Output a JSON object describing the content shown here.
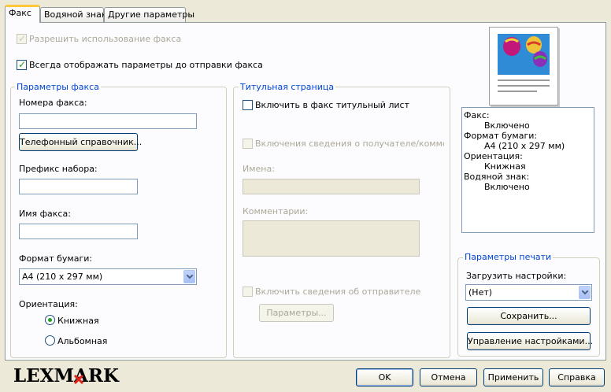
{
  "tabs": [
    "Факс",
    "Водяной знак",
    "Другие параметры"
  ],
  "options": {
    "allow_fax": "Разрешить использование факса",
    "always_show": "Всегда отображать параметры до отправки факса"
  },
  "fax_params": {
    "title": "Параметры факса",
    "fax_numbers_label": "Номера факса:",
    "fax_numbers_value": "",
    "phonebook_button": "Телефонный справочник...",
    "dial_prefix_label": "Префикс набора:",
    "dial_prefix_value": "",
    "fax_name_label": "Имя факса:",
    "fax_name_value": "",
    "paper_size_label": "Формат бумаги:",
    "paper_size_value": "A4 (210 x 297 мм)",
    "orientation_label": "Ориентация:",
    "portrait": "Книжная",
    "landscape": "Альбомная"
  },
  "cover_page": {
    "title": "Титульная страница",
    "include_cover": "Включить в факс титульный лист",
    "include_recipient": "Включения сведения о получателе/комментари",
    "names_label": "Имена:",
    "comments_label": "Комментарии:",
    "include_sender": "Включить сведения об отправителе",
    "params_button": "Параметры..."
  },
  "summary": [
    {
      "key": "Факс:",
      "value": "Включено"
    },
    {
      "key": "Формат бумаги:",
      "value": "A4 (210 x 297 мм)"
    },
    {
      "key": "Ориентация:",
      "value": "Книжная"
    },
    {
      "key": "Водяной знак:",
      "value": "Включено"
    }
  ],
  "print_params": {
    "title": "Параметры печати",
    "load_label": "Загрузить настройки:",
    "load_value": "(Нет)",
    "save_button": "Сохранить...",
    "manage_button": "Управление настройками..."
  },
  "footer": {
    "logo": "LEXMARK",
    "ok": "OK",
    "cancel": "Отмена",
    "apply": "Применить",
    "help": "Справка"
  },
  "colors": {
    "accent_group_title": "#0046d5",
    "check_green": "#21a121",
    "logo_red": "#e2231a"
  }
}
